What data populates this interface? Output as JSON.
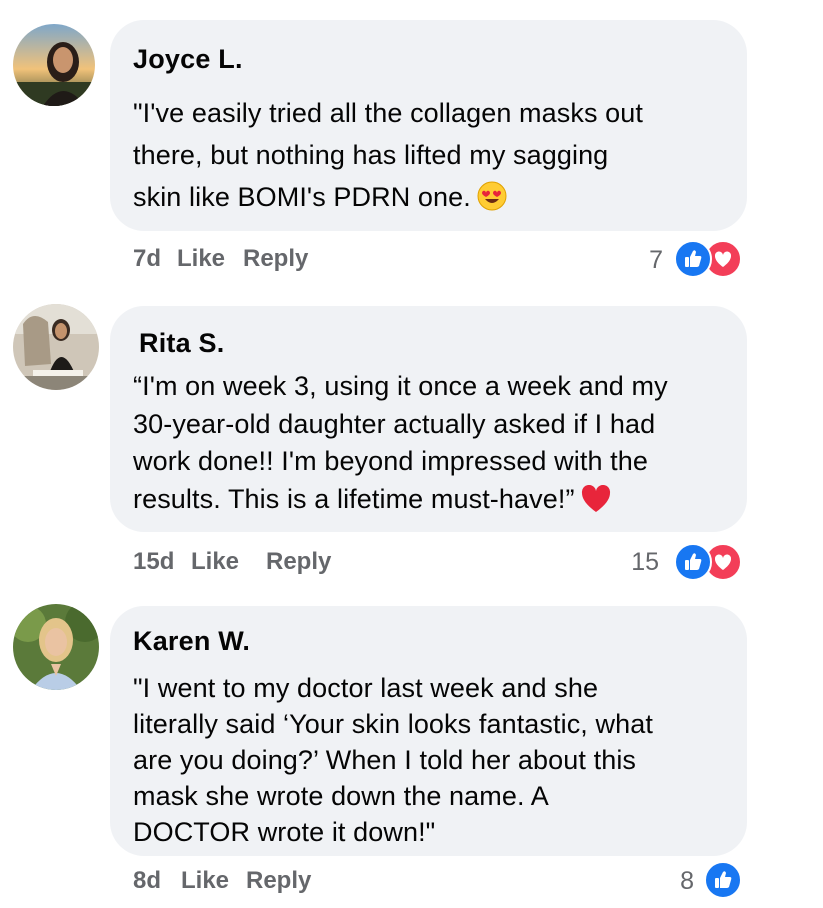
{
  "comments": [
    {
      "author": "Joyce L.",
      "text": "\"I've easily tried all the collagen masks out\nthere, but nothing has lifted my sagging\nskin like BOMI's PDRN one.",
      "age": "7d",
      "like_label": "Like",
      "reply_label": "Reply",
      "reaction_count": "7",
      "reactions": [
        "like-icon",
        "love-icon"
      ],
      "trailing_emoji": "heart-eyes-emoji"
    },
    {
      "author": "Rita S.",
      "text": "“I'm on week 3, using it once a week and my\n30-year-old daughter actually asked if I had\nwork done!! I'm beyond impressed with the\nresults. This is a lifetime must-have!”",
      "age": "15d",
      "like_label": "Like",
      "reply_label": "Reply",
      "reaction_count": "15",
      "reactions": [
        "like-icon",
        "love-icon"
      ],
      "trailing_emoji": "red-heart-emoji"
    },
    {
      "author": "Karen W.",
      "text": "\"I went to my doctor last week and she\nliterally said ‘Your skin looks fantastic, what\nare you doing?’ When I told her about this\nmask she wrote down the name. A\nDOCTOR wrote it down!\"",
      "age": "8d",
      "like_label": "Like",
      "reply_label": "Reply",
      "reaction_count": "8",
      "reactions": [
        "like-icon"
      ]
    }
  ],
  "colors": {
    "bubble": "#f0f2f5",
    "meta": "#65676b",
    "like": "#1877f2",
    "love": "#f33e58"
  }
}
